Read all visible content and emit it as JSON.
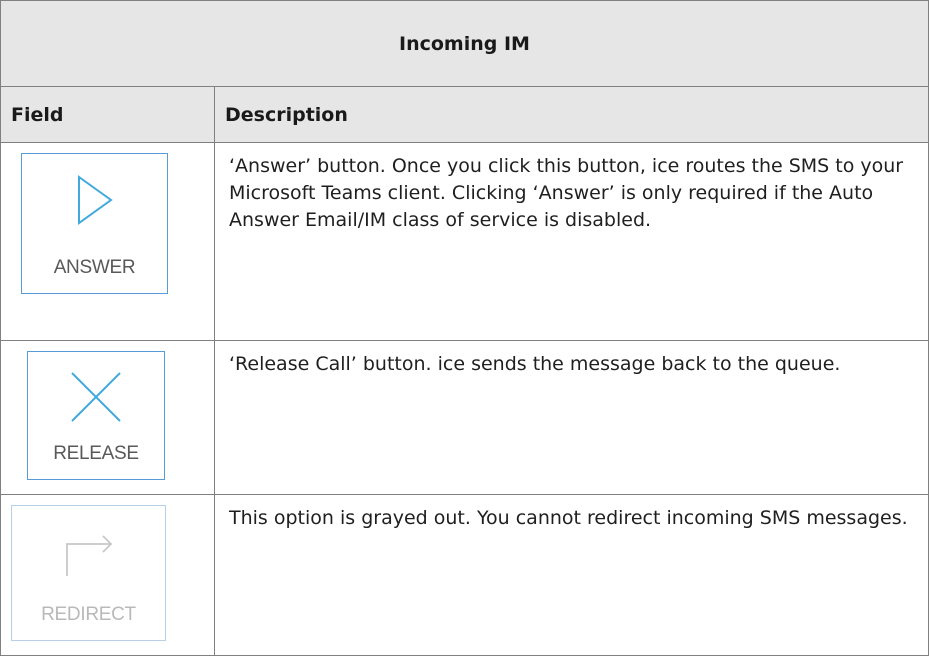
{
  "table": {
    "title": "Incoming IM",
    "headers": {
      "field": "Field",
      "description": "Description"
    },
    "rows": [
      {
        "button_label": "ANSWER",
        "icon": "play-triangle-icon",
        "description": "‘Answer’ button. Once you click this button, ice routes the SMS to your Microsoft Teams client. Clicking ‘Answer’ is only required if the Auto Answer Email/IM class of service is disabled."
      },
      {
        "button_label": "RELEASE",
        "icon": "x-close-icon",
        "description": "‘Release Call’ button. ice sends the message back to the queue."
      },
      {
        "button_label": "REDIRECT",
        "icon": "redirect-arrow-icon",
        "description": "This option is grayed out. You cannot redirect incoming SMS messages."
      }
    ]
  },
  "colors": {
    "header_bg": "#e6e6e6",
    "icon_blue": "#41a9e0",
    "disabled_gray": "#bfbfbf"
  }
}
